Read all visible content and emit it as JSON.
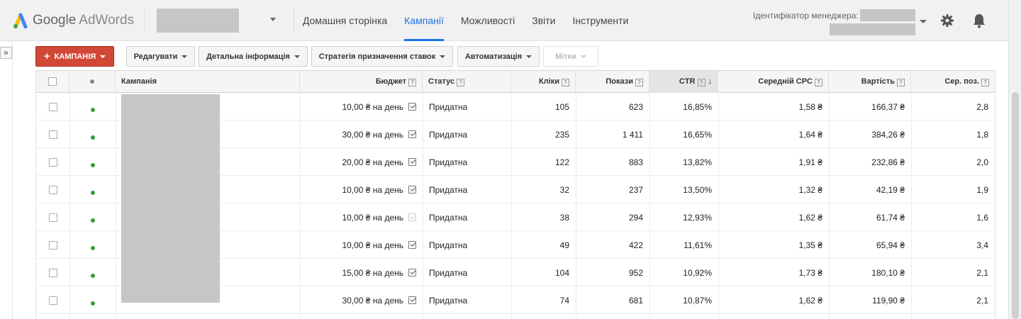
{
  "header": {
    "logo_google": "Google",
    "logo_product": "AdWords",
    "nav": [
      {
        "label": "Домашня сторінка",
        "active": false
      },
      {
        "label": "Кампанії",
        "active": true
      },
      {
        "label": "Можливості",
        "active": false
      },
      {
        "label": "Звіти",
        "active": false
      },
      {
        "label": "Інструменти",
        "active": false
      }
    ],
    "manager_label": "Ідентифікатор менеджера:",
    "icons": [
      "gear-icon",
      "bell-icon"
    ]
  },
  "sidebar": {
    "toggle_label": "»"
  },
  "toolbar": {
    "campaign_button": "КАМПАНІЯ",
    "edit": "Редагувати",
    "details": "Детальна інформація",
    "bid_strategy": "Стратегія призначення ставок",
    "automation": "Автоматизація",
    "labels": "Мітки"
  },
  "table": {
    "columns": {
      "campaign": "Кампанія",
      "budget": "Бюджет",
      "status": "Статус",
      "clicks": "Кліки",
      "impressions": "Покази",
      "ctr": "CTR",
      "avg_cpc": "Середній CPC",
      "cost": "Вартість",
      "avg_pos": "Сер. поз."
    },
    "help_mark": "?",
    "sort_arrow": "↓",
    "rows": [
      {
        "budget": "10,00 ₴ на день",
        "status": "Придатна",
        "clicks": "105",
        "impressions": "623",
        "ctr": "16,85%",
        "avg_cpc": "1,58 ₴",
        "cost": "166,37 ₴",
        "avg_pos": "2,8",
        "edit_faint": false
      },
      {
        "budget": "30,00 ₴ на день",
        "status": "Придатна",
        "clicks": "235",
        "impressions": "1 411",
        "ctr": "16,65%",
        "avg_cpc": "1,64 ₴",
        "cost": "384,26 ₴",
        "avg_pos": "1,8",
        "edit_faint": false
      },
      {
        "budget": "20,00 ₴ на день",
        "status": "Придатна",
        "clicks": "122",
        "impressions": "883",
        "ctr": "13,82%",
        "avg_cpc": "1,91 ₴",
        "cost": "232,86 ₴",
        "avg_pos": "2,0",
        "edit_faint": false
      },
      {
        "budget": "10,00 ₴ на день",
        "status": "Придатна",
        "clicks": "32",
        "impressions": "237",
        "ctr": "13,50%",
        "avg_cpc": "1,32 ₴",
        "cost": "42,19 ₴",
        "avg_pos": "1,9",
        "edit_faint": false
      },
      {
        "budget": "10,00 ₴ на день",
        "status": "Придатна",
        "clicks": "38",
        "impressions": "294",
        "ctr": "12,93%",
        "avg_cpc": "1,62 ₴",
        "cost": "61,74 ₴",
        "avg_pos": "1,6",
        "edit_faint": true
      },
      {
        "budget": "10,00 ₴ на день",
        "status": "Придатна",
        "clicks": "49",
        "impressions": "422",
        "ctr": "11,61%",
        "avg_cpc": "1,35 ₴",
        "cost": "65,94 ₴",
        "avg_pos": "3,4",
        "edit_faint": false
      },
      {
        "budget": "15,00 ₴ на день",
        "status": "Придатна",
        "clicks": "104",
        "impressions": "952",
        "ctr": "10,92%",
        "avg_cpc": "1,73 ₴",
        "cost": "180,10 ₴",
        "avg_pos": "2,1",
        "edit_faint": false
      },
      {
        "budget": "30,00 ₴ на день",
        "status": "Придатна",
        "clicks": "74",
        "impressions": "681",
        "ctr": "10,87%",
        "avg_cpc": "1,62 ₴",
        "cost": "119,90 ₴",
        "avg_pos": "2,1",
        "edit_faint": false
      }
    ]
  },
  "colors": {
    "accent_blue": "#1a73e8",
    "primary_red": "#d14836",
    "status_green": "#3a9a3a",
    "redacted_gray": "#c6c6c6"
  }
}
